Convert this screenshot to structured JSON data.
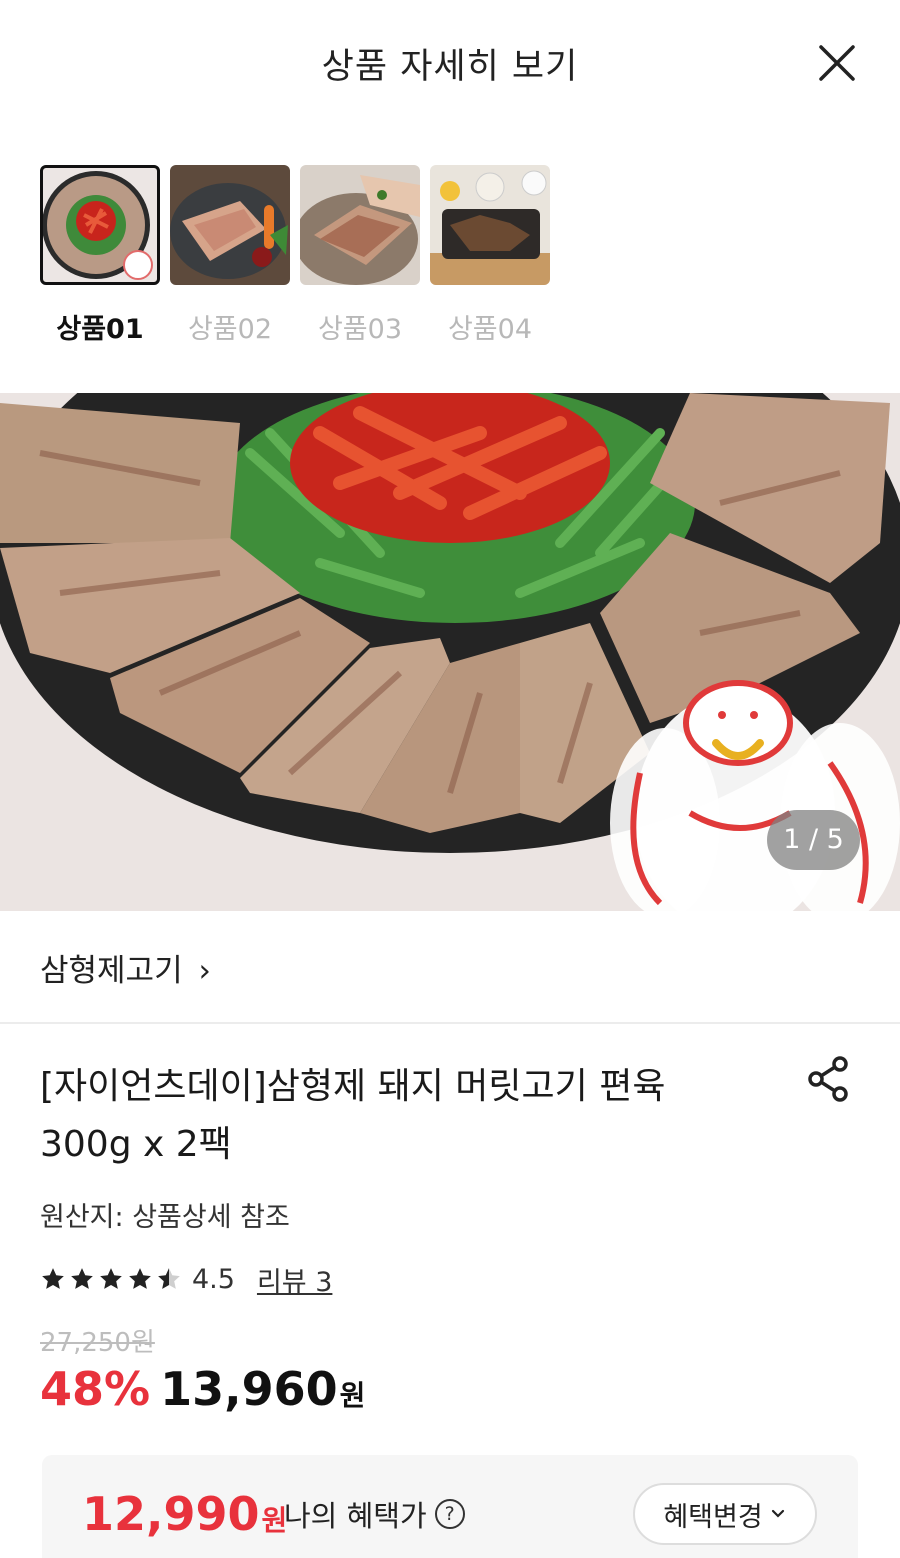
{
  "header": {
    "title": "상품 자세히 보기"
  },
  "thumbnails": [
    {
      "label": "상품01",
      "active": true
    },
    {
      "label": "상품02",
      "active": false
    },
    {
      "label": "상품03",
      "active": false
    },
    {
      "label": "상품04",
      "active": false
    }
  ],
  "gallery": {
    "counter": "1 / 5",
    "current": 1,
    "total": 5
  },
  "store": {
    "name": "삼형제고기",
    "chevron": "›"
  },
  "product": {
    "name_line1": "[자이언츠데이]삼형제 돼지 머릿고기 편육",
    "name_line2": "300g x 2팩",
    "origin": "원산지: 상품상세 참조"
  },
  "rating": {
    "value": "4.5",
    "stars": 4.5,
    "review_label": "리뷰 3"
  },
  "pricing": {
    "original": "27,250원",
    "discount": "48%",
    "price": "13,960",
    "unit": "원"
  },
  "benefit": {
    "amount": "12,990",
    "unit": "원",
    "label": "나의 혜택가",
    "help": "?",
    "change_label": "혜택변경"
  },
  "colors": {
    "accent_red": "#e8323c",
    "text": "#111111",
    "muted": "#bdbdbd"
  }
}
